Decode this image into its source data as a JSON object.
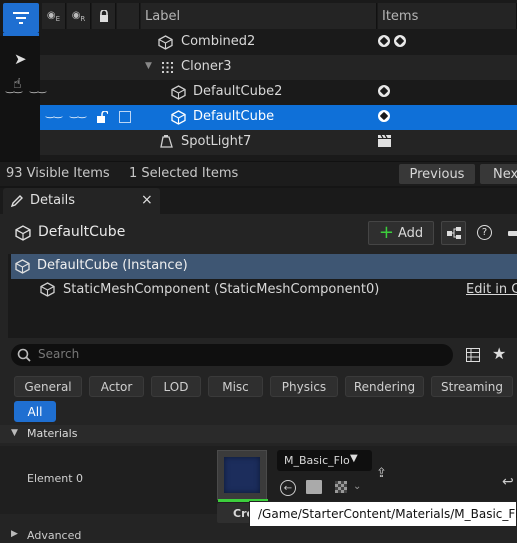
{
  "outliner": {
    "columns": {
      "label": "Label",
      "items": "Items"
    },
    "rows": [
      {
        "label": "Combined2",
        "icon": "static-mesh-icon",
        "items_count": 2,
        "selected": false
      },
      {
        "label": "Cloner3",
        "icon": "cloner-icon",
        "items_count": 0,
        "selected": false
      },
      {
        "label": "DefaultCube2",
        "icon": "static-mesh-icon",
        "items_count": 1,
        "selected": false
      },
      {
        "label": "DefaultCube",
        "icon": "static-mesh-icon",
        "items_count": 1,
        "selected": true
      },
      {
        "label": "SpotLight7",
        "icon": "spotlight-icon",
        "items_count": 1,
        "selected": false
      }
    ],
    "status": {
      "visible_items": "93 Visible Items",
      "selected_items": "1 Selected Items",
      "previous": "Previous",
      "next": "Nex"
    },
    "accent": "#1f6fd1"
  },
  "details": {
    "tab_label": "Details",
    "tab_close": "×",
    "actor_name": "DefaultCube",
    "add_label": "Add",
    "components": {
      "instance": "DefaultCube (Instance)",
      "mesh_component": "StaticMeshComponent (StaticMeshComponent0)",
      "edit_link": "Edit in C+"
    },
    "search_placeholder": "Search",
    "filters": [
      "General",
      "Actor",
      "LOD",
      "Misc",
      "Physics",
      "Rendering",
      "Streaming",
      "All"
    ],
    "active_filter": "All",
    "materials": {
      "section": "Materials",
      "element_label": "Element 0",
      "material_value": "M_Basic_Flo",
      "create_label": "Cre",
      "tooltip": "/Game/StarterContent/Materials/M_Basic_Floor"
    },
    "advanced_label": "Advanced"
  }
}
